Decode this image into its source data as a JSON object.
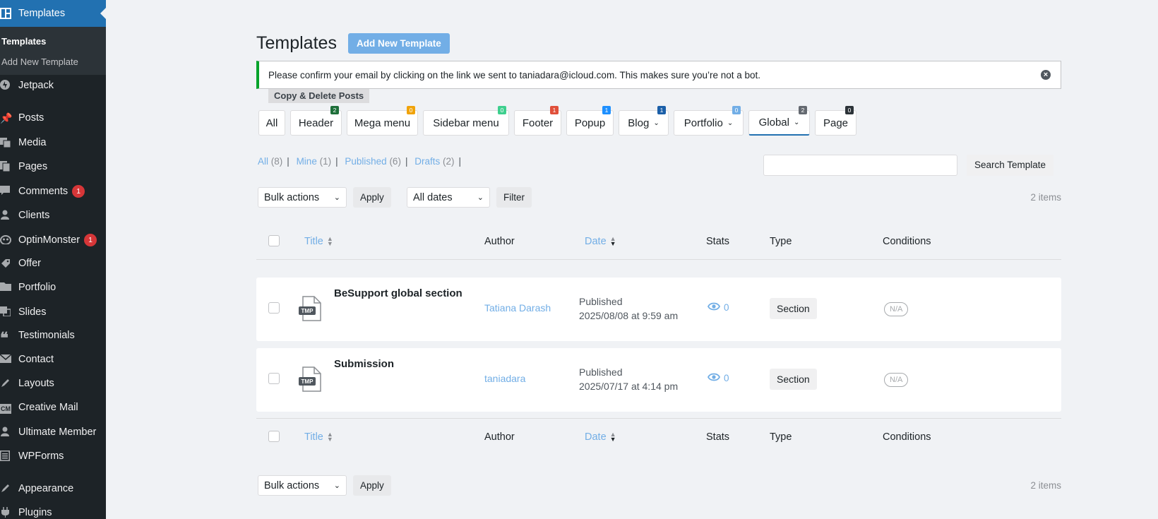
{
  "sidebar": {
    "current": {
      "label": "Templates"
    },
    "submenu": [
      {
        "label": "Templates"
      },
      {
        "label": "Add New Template"
      }
    ],
    "items": [
      {
        "label": "Jetpack",
        "icon": "jetpack-icon"
      },
      {
        "label": "Posts",
        "icon": "pin-icon"
      },
      {
        "label": "Media",
        "icon": "media-icon"
      },
      {
        "label": "Pages",
        "icon": "pages-icon"
      },
      {
        "label": "Comments",
        "icon": "comment-icon",
        "badge": "1"
      },
      {
        "label": "Clients",
        "icon": "user-icon"
      },
      {
        "label": "OptinMonster",
        "icon": "optinmonster-icon",
        "badge": "1"
      },
      {
        "label": "Offer",
        "icon": "tag-icon"
      },
      {
        "label": "Portfolio",
        "icon": "folder-icon"
      },
      {
        "label": "Slides",
        "icon": "slides-icon"
      },
      {
        "label": "Testimonials",
        "icon": "quote-icon"
      },
      {
        "label": "Contact",
        "icon": "mail-icon"
      },
      {
        "label": "Layouts",
        "icon": "brush-icon"
      },
      {
        "label": "Creative Mail",
        "icon": "cm-icon",
        "icon_text": "CM"
      },
      {
        "label": "Ultimate Member",
        "icon": "user-icon"
      },
      {
        "label": "WPForms",
        "icon": "forms-icon"
      },
      {
        "label": "Appearance",
        "icon": "brush-icon"
      },
      {
        "label": "Plugins",
        "icon": "plugin-icon"
      }
    ]
  },
  "header": {
    "title": "Templates",
    "add_new": "Add New Template"
  },
  "notice": {
    "text": "Please confirm your email by clicking on the link we sent to taniadara@icloud.com. This makes sure you’re not a bot."
  },
  "copy_delete": "Copy & Delete Posts",
  "tabs": [
    {
      "label": "All"
    },
    {
      "label": "Header",
      "badge": "2",
      "badge_color": "#1e6f3a"
    },
    {
      "label": "Mega menu",
      "badge": "0",
      "badge_color": "#f0a30a"
    },
    {
      "label": "Sidebar menu",
      "badge": "0",
      "badge_color": "#3ecf8e"
    },
    {
      "label": "Footer",
      "badge": "1",
      "badge_color": "#e04f3a"
    },
    {
      "label": "Popup",
      "badge": "1",
      "badge_color": "#1e90ff"
    },
    {
      "label": "Blog",
      "badge": "1",
      "badge_color": "#1b5fa8"
    },
    {
      "label": "Portfolio",
      "badge": "0",
      "badge_color": "#72aee6"
    },
    {
      "label": "Global",
      "badge": "2",
      "badge_color": "#646970"
    },
    {
      "label": "Page",
      "badge": "0",
      "badge_color": "#2c3338"
    }
  ],
  "views": [
    {
      "label": "All",
      "count": "(8)"
    },
    {
      "label": "Mine",
      "count": "(1)"
    },
    {
      "label": "Published",
      "count": "(6)"
    },
    {
      "label": "Drafts",
      "count": "(2)"
    }
  ],
  "search": {
    "button": "Search Template",
    "value": ""
  },
  "toolbar": {
    "bulk_actions": "Bulk actions",
    "apply": "Apply",
    "dates": "All dates",
    "filter": "Filter",
    "items_count": "2 items"
  },
  "table": {
    "columns": {
      "title": "Title",
      "author": "Author",
      "date": "Date",
      "stats": "Stats",
      "type": "Type",
      "conditions": "Conditions"
    },
    "file_icon_text": "TMP",
    "rows": [
      {
        "title": "BeSupport global section",
        "author": "Tatiana Darash",
        "status": "Published",
        "date": "2025/08/08 at 9:59 am",
        "stats": "0",
        "type": "Section",
        "conditions": "N/A"
      },
      {
        "title": "Submission",
        "author": "taniadara",
        "status": "Published",
        "date": "2025/07/17 at 4:14 pm",
        "stats": "0",
        "type": "Section",
        "conditions": "N/A"
      }
    ]
  }
}
